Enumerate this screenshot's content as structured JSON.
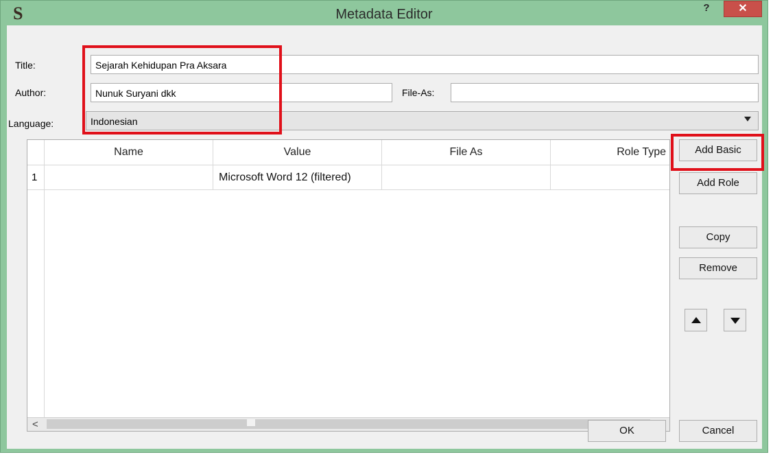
{
  "window": {
    "title": "Metadata Editor",
    "app_icon": "S",
    "help": "?",
    "close": "✕"
  },
  "form": {
    "title_label": "Title:",
    "title_value": "Sejarah Kehidupan Pra Aksara",
    "author_label": "Author:",
    "author_value": "Nunuk Suryani dkk",
    "file_as_label": "File-As:",
    "file_as_value": "",
    "language_label": "Language:",
    "language_value": "Indonesian"
  },
  "table": {
    "columns": [
      "Name",
      "Value",
      "File As",
      "Role Type"
    ],
    "rows": [
      {
        "num": "1",
        "name": "",
        "value": "Microsoft Word 12 (filtered)",
        "file_as": "",
        "role_type": ""
      }
    ],
    "scroll_left": "<",
    "scroll_right": ">"
  },
  "buttons": {
    "add_basic": "Add Basic",
    "add_role": "Add Role",
    "copy": "Copy",
    "remove": "Remove",
    "ok": "OK",
    "cancel": "Cancel"
  },
  "colors": {
    "frame": "#8ec79d",
    "close": "#c9504a",
    "highlight": "#e0101a"
  }
}
